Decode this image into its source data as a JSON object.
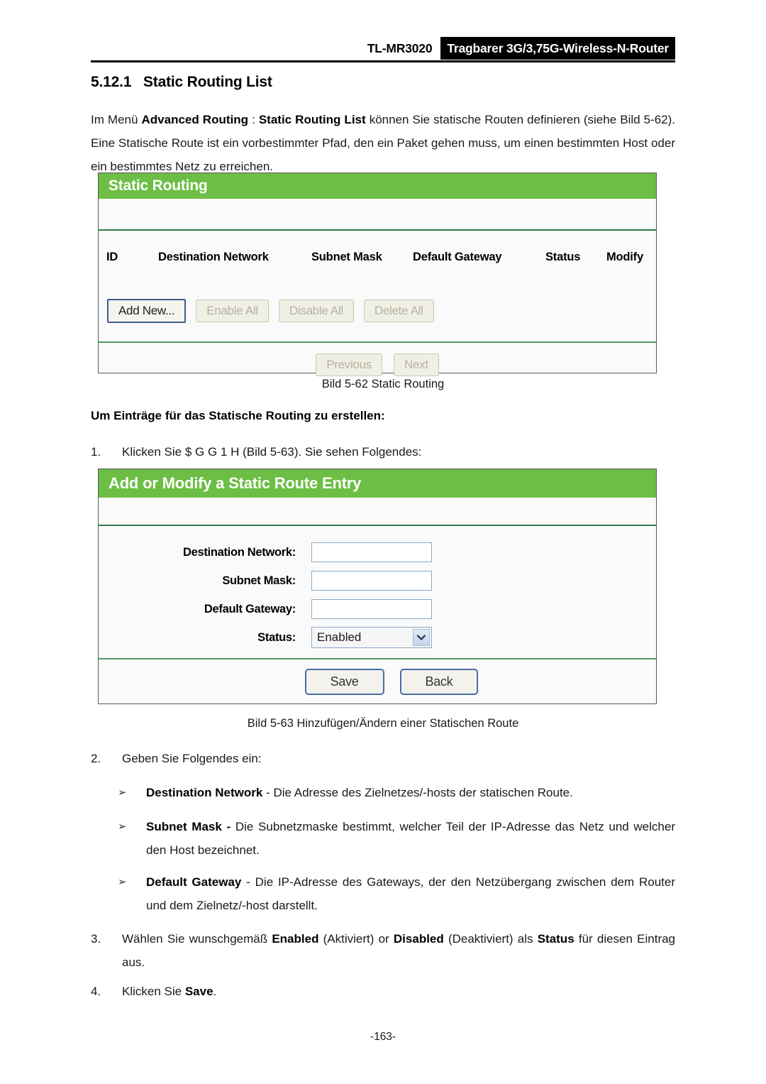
{
  "header": {
    "model": "TL-MR3020",
    "product": "Tragbarer 3G/3,75G-Wireless-N-Router"
  },
  "section": {
    "number": "5.12.1",
    "title": "Static Routing List"
  },
  "intro_paragraph": {
    "part1": "Im Menü ",
    "bold1": "Advanced Routing",
    "part2": "  :   ",
    "bold2": "Static Routing List",
    "part3": " können Sie statische Routen definieren (siehe Bild 5-62). Eine Statische Route ist ein vorbestimmter Pfad, den ein Paket gehen muss, um einen bestimmten Host oder ein bestimmtes Netz zu erreichen."
  },
  "panel_static_routing": {
    "title": "Static Routing",
    "columns": [
      "ID",
      "Destination Network",
      "Subnet Mask",
      "Default Gateway",
      "Status",
      "Modify"
    ],
    "rows": [],
    "buttons": [
      {
        "label": "Add New...",
        "state": "enabled"
      },
      {
        "label": "Enable All",
        "state": "disabled"
      },
      {
        "label": "Disable All",
        "state": "disabled"
      },
      {
        "label": "Delete All",
        "state": "disabled"
      }
    ],
    "pager": [
      {
        "label": "Previous",
        "state": "disabled"
      },
      {
        "label": "Next",
        "state": "disabled"
      }
    ]
  },
  "caption_1": "Bild 5-62 Static Routing",
  "subhead_1": "Um Einträge für das Statische Routing zu erstellen:",
  "step_1": {
    "marker": "1.",
    "text": "Klicken Sie  $ G G   1 H (Bild 5-63). Sie sehen Folgendes:"
  },
  "panel_add_route": {
    "title": "Add or Modify a Static Route Entry",
    "fields": [
      {
        "label": "Destination Network:",
        "value": "",
        "type": "text"
      },
      {
        "label": "Subnet Mask:",
        "value": "",
        "type": "text"
      },
      {
        "label": "Default Gateway:",
        "value": "",
        "type": "text"
      },
      {
        "label": "Status:",
        "value": "Enabled",
        "type": "select"
      }
    ],
    "buttons": [
      {
        "label": "Save"
      },
      {
        "label": "Back"
      }
    ]
  },
  "caption_2": "Bild 5-63 Hinzufügen/Ändern einer Statischen Route",
  "step_2": {
    "marker": "2.",
    "text": "Geben Sie Folgendes ein:"
  },
  "bullets": [
    {
      "arrow": "➢",
      "bold": "Destination Network",
      "text": " - Die Adresse des Zielnetzes/-hosts der statischen Route."
    },
    {
      "arrow": "➢",
      "bold": "Subnet Mask -",
      "text": " Die Subnetzmaske bestimmt, welcher Teil der IP-Adresse das Netz und welcher den Host bezeichnet."
    },
    {
      "arrow": "➢",
      "bold": "Default Gateway",
      "text": " - Die IP-Adresse des Gateways, der den Netzübergang zwischen dem Router und dem Zielnetz/-host darstellt."
    }
  ],
  "step_3": {
    "marker": "3.",
    "part1": "Wählen Sie wunschgemäß ",
    "bold1": "Enabled",
    "part2": " (Aktiviert) or ",
    "bold2": "Disabled",
    "part3": " (Deaktiviert) als ",
    "bold3": "Status",
    "part4": " für diesen Eintrag aus."
  },
  "step_4": {
    "marker": "4.",
    "part1": "Klicken Sie ",
    "bold1": "Save",
    "part2": "."
  },
  "page_number": "-163-",
  "colors": {
    "panel_green": "#6cbe45",
    "divider_green": "#2f7d4f",
    "header_black": "#000000"
  }
}
